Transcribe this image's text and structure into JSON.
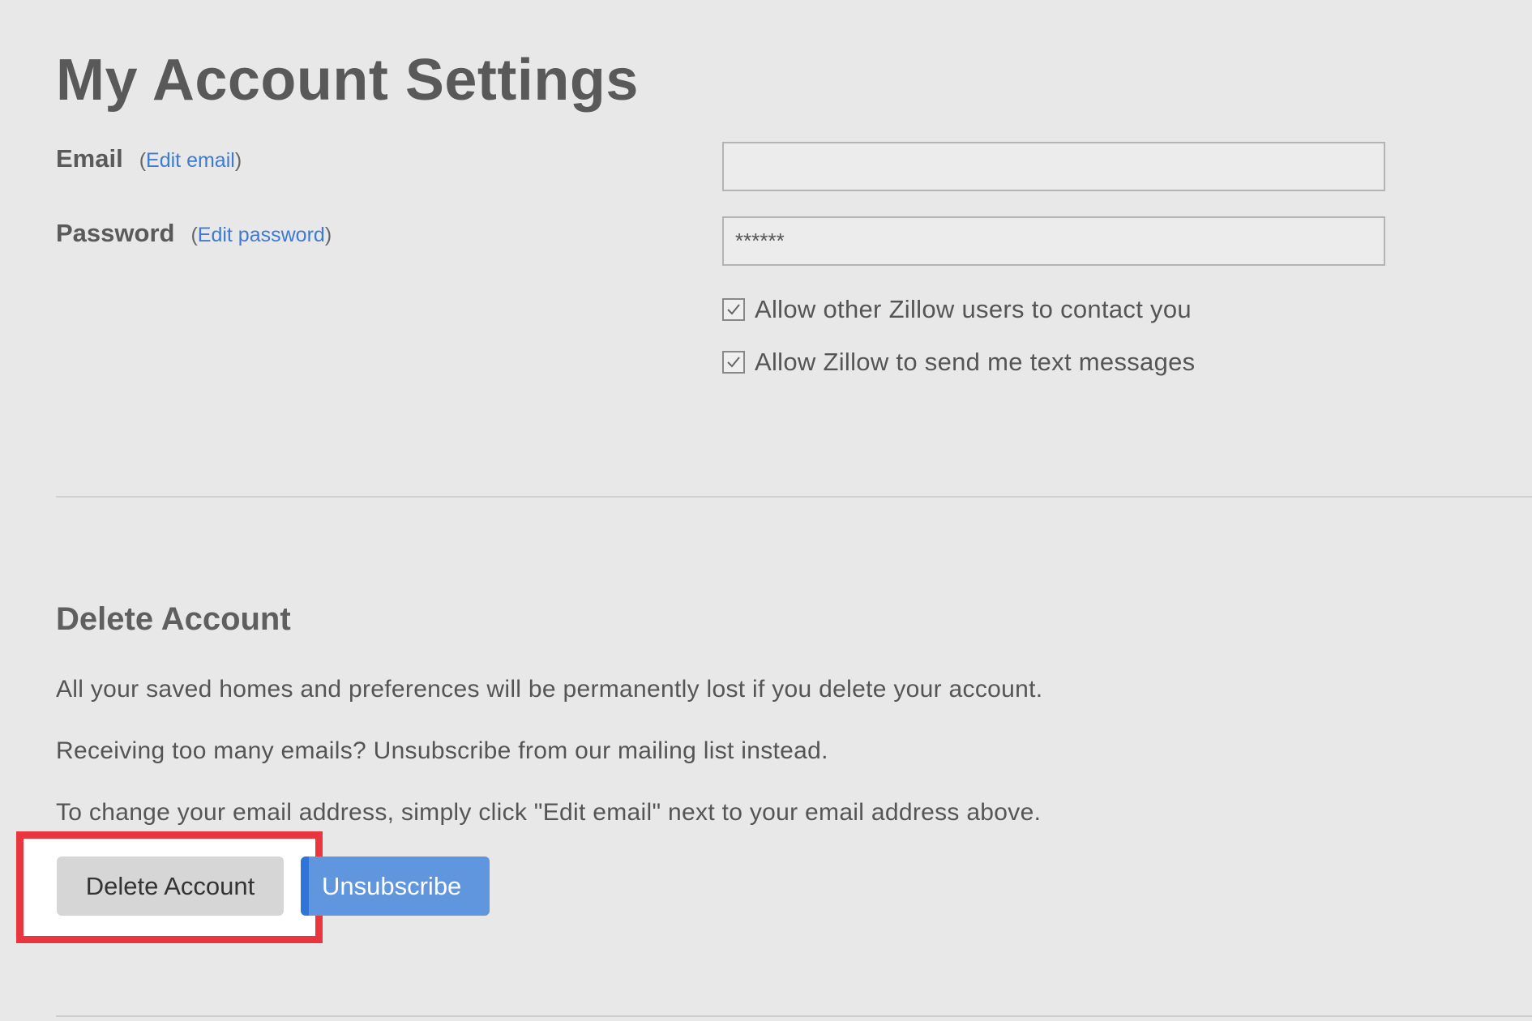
{
  "page": {
    "title": "My Account Settings"
  },
  "account": {
    "email_label": "Email",
    "email_edit_link": "Edit email",
    "email_value": "",
    "password_label": "Password",
    "password_edit_link": "Edit password",
    "password_value": "******"
  },
  "preferences": [
    {
      "label": "Allow other Zillow users to contact you",
      "checked": true
    },
    {
      "label": "Allow Zillow to send me text messages",
      "checked": true
    }
  ],
  "delete_section": {
    "title": "Delete Account",
    "paragraphs": [
      "All your saved homes and preferences will be permanently lost if you delete your account.",
      "Receiving too many emails? Unsubscribe from our mailing list instead.",
      "To change your email address, simply click \"Edit email\" next to your email address above."
    ],
    "delete_button": "Delete Account",
    "unsubscribe_button": "Unsubscribe"
  },
  "colors": {
    "link": "#3e7bd0",
    "primary_button": "#5f96dd",
    "highlight": "#e8353e",
    "background": "#e8e8e8"
  }
}
